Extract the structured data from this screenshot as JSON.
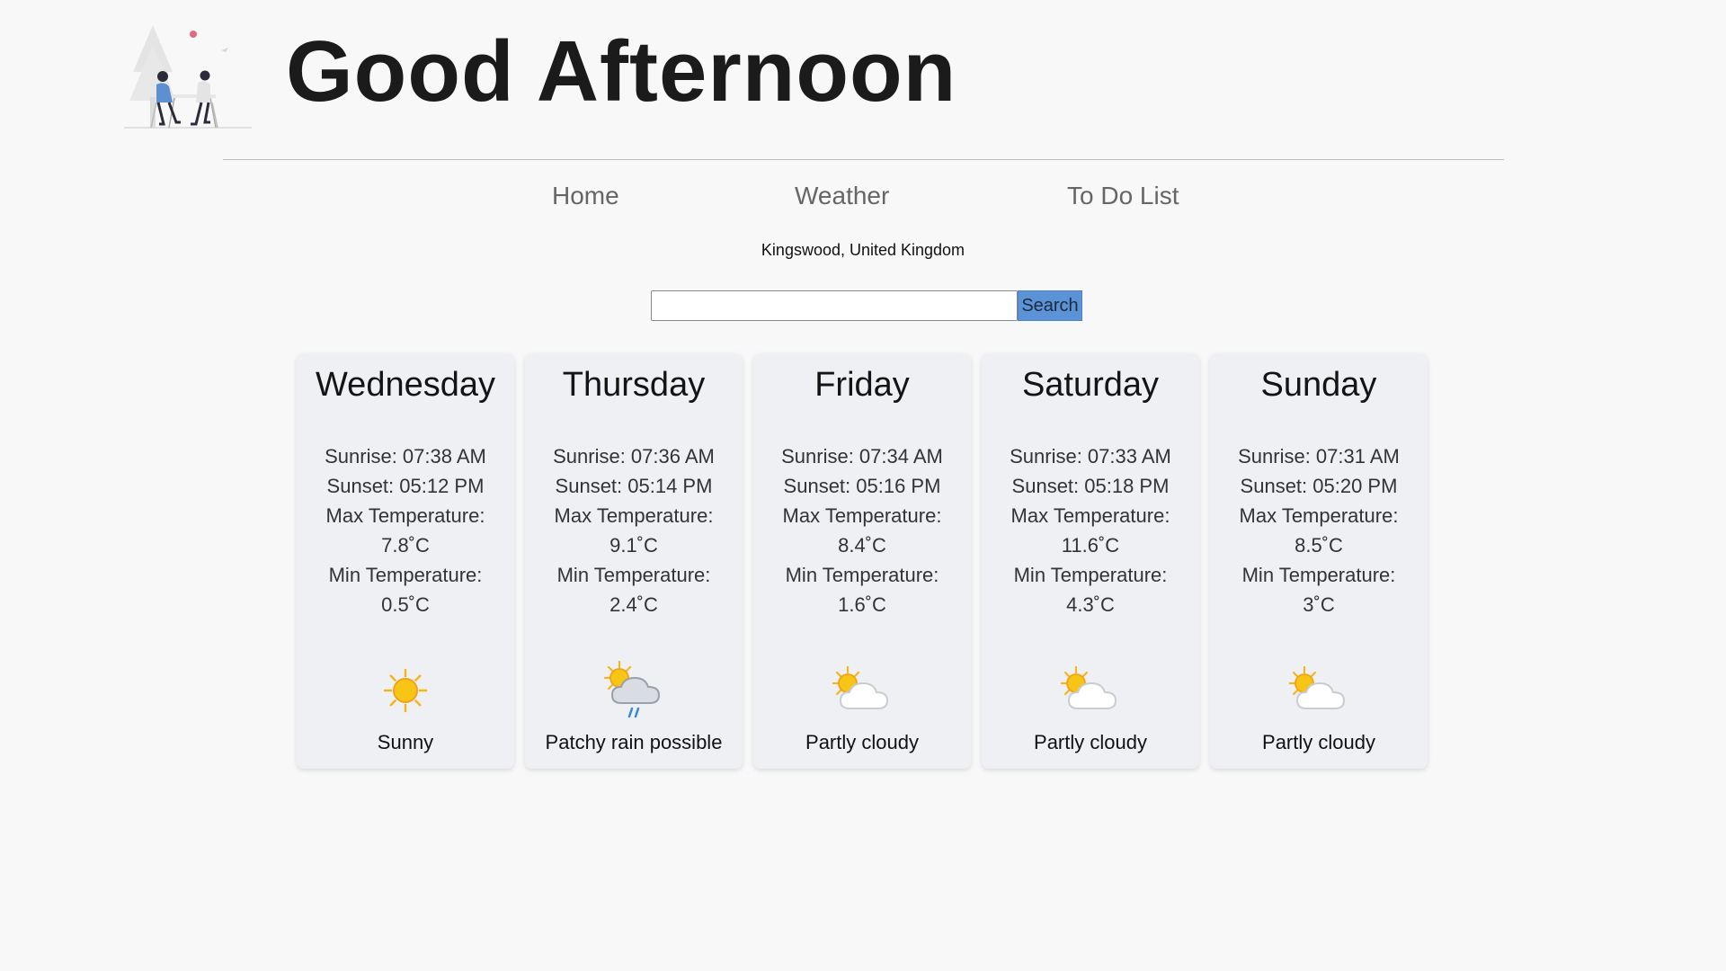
{
  "greeting": "Good Afternoon",
  "hero_image_icon": "couple-at-table-illustration",
  "nav": {
    "home": "Home",
    "weather": "Weather",
    "todo": "To Do List"
  },
  "location": "Kingswood, United Kingdom",
  "search": {
    "value": "",
    "placeholder": "",
    "button_label": "Search"
  },
  "colors": {
    "background": "#f8f8f8",
    "card": "#eef0f4",
    "search_button": "#5b93d6",
    "nav_text": "#666666"
  },
  "forecast": [
    {
      "day": "Wednesday",
      "sunrise": "Sunrise: 07:38 AM",
      "sunset": "Sunset: 05:12 PM",
      "max_label": "Max Temperature:",
      "max_value": "7.8˚C",
      "min_label": "Min Temperature:",
      "min_value": "0.5˚C",
      "icon": "sun-icon",
      "condition": "Sunny"
    },
    {
      "day": "Thursday",
      "sunrise": "Sunrise: 07:36 AM",
      "sunset": "Sunset: 05:14 PM",
      "max_label": "Max Temperature:",
      "max_value": "9.1˚C",
      "min_label": "Min Temperature:",
      "min_value": "2.4˚C",
      "icon": "rain-cloud-sun-icon",
      "condition": "Patchy rain possible"
    },
    {
      "day": "Friday",
      "sunrise": "Sunrise: 07:34 AM",
      "sunset": "Sunset: 05:16 PM",
      "max_label": "Max Temperature:",
      "max_value": "8.4˚C",
      "min_label": "Min Temperature:",
      "min_value": "1.6˚C",
      "icon": "partly-cloudy-icon",
      "condition": "Partly cloudy"
    },
    {
      "day": "Saturday",
      "sunrise": "Sunrise: 07:33 AM",
      "sunset": "Sunset: 05:18 PM",
      "max_label": "Max Temperature:",
      "max_value": "11.6˚C",
      "min_label": "Min Temperature:",
      "min_value": "4.3˚C",
      "icon": "partly-cloudy-icon",
      "condition": "Partly cloudy"
    },
    {
      "day": "Sunday",
      "sunrise": "Sunrise: 07:31 AM",
      "sunset": "Sunset: 05:20 PM",
      "max_label": "Max Temperature:",
      "max_value": "8.5˚C",
      "min_label": "Min Temperature:",
      "min_value": "3˚C",
      "icon": "partly-cloudy-icon",
      "condition": "Partly cloudy"
    }
  ]
}
